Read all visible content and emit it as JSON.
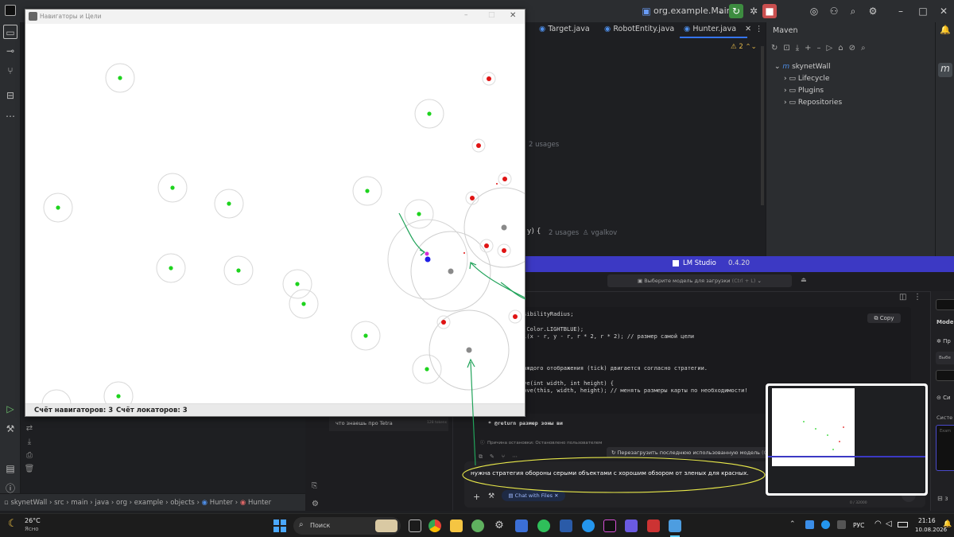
{
  "ide": {
    "run_config": "org.example.Main",
    "tabs": [
      {
        "label": "Target.java"
      },
      {
        "label": "RobotEntity.java"
      },
      {
        "label": "Hunter.java",
        "active": true
      }
    ],
    "warning_count": "2",
    "editor_hints": {
      "usages_1": "2 usages",
      "usages_2": "2 usages",
      "author": "vgalkov",
      "code_brace": "y) {"
    },
    "maven": {
      "title": "Maven",
      "project": "skynetWall",
      "items": [
        "Lifecycle",
        "Plugins",
        "Repositories"
      ]
    },
    "breadcrumbs": [
      "skynetWall",
      "src",
      "main",
      "java",
      "org",
      "example",
      "objects",
      "Hunter",
      "Hunter"
    ]
  },
  "java_window": {
    "title": "Навигаторы и Цели",
    "status_navigators": "Счёт навигаторов: 3",
    "status_locators": "Счёт локаторов: 3"
  },
  "lm_studio": {
    "title": "LM Studio",
    "version": "0.4.20",
    "model_select": "Выберите модель для загрузки",
    "model_shortcut": "(Ctrl + L)",
    "copy_label": "Copy",
    "code_lines": [
      "isibilityRadius;",
      "",
      "r(Color.LIGHTBLUE);",
      "al(x - r, y - r, r * 2, r * 2); // размер самой цели",
      "",
      "",
      "каждого отображения (tick) двигается согласно стратегии.",
      "",
      "ove(int width, int height) {",
      "move(this, width, height); // менять размеры карты по необходимости!"
    ],
    "doc_comment": "* @return размер зоны ви",
    "chat_item": "что знаешь про Tetra",
    "chat_item_meta": "128 tokens",
    "stop_reason": "Причина остановки: Остановлено пользователем",
    "reload_label": "Перезагрузить последнюю использованную модель",
    "reload_shortcut": "(Ctrl",
    "user_message": "нужна стратегия обороны серыми объектами с хорошим обзором от зленых для красных.",
    "chip_label": "Chat with Files",
    "token_count": "0 / 32000",
    "side_labels": [
      "Model",
      "Пр",
      "Выбе",
      "Си",
      "Систе",
      "Exam"
    ]
  },
  "taskbar": {
    "weather_temp": "26°C",
    "weather_desc": "Ясно",
    "search_placeholder": "Поиск",
    "lang": "РУС",
    "time": "21:16",
    "date": "10.08.2026"
  }
}
